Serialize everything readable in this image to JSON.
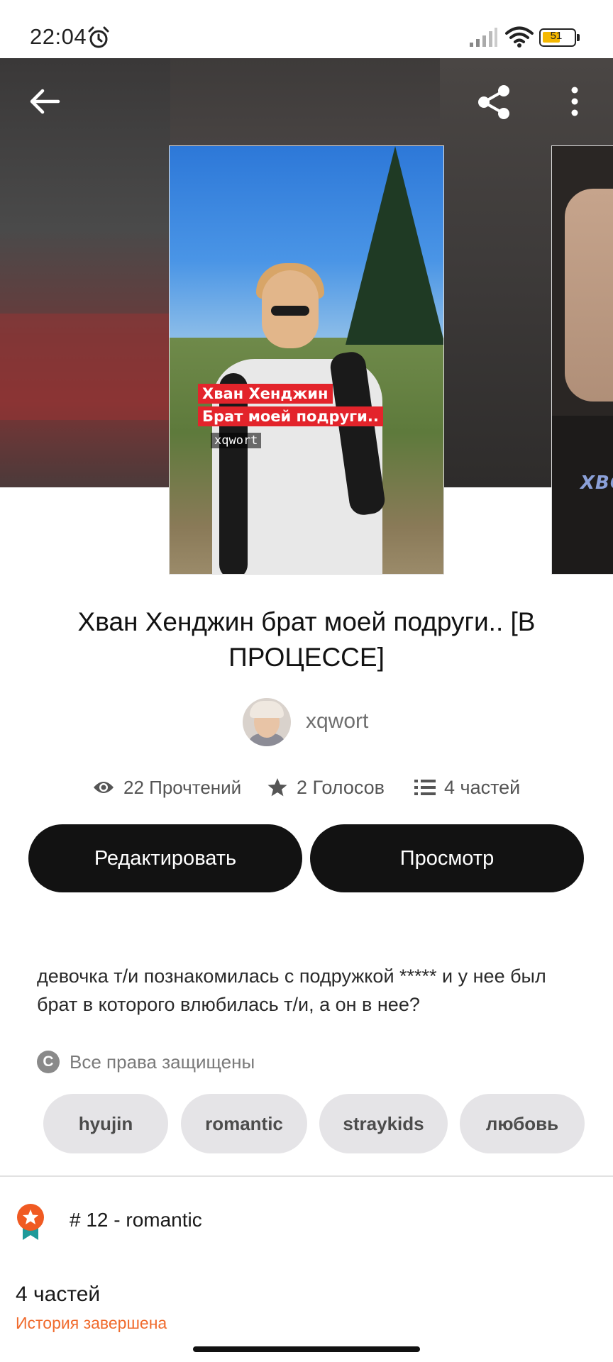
{
  "status_bar": {
    "time": "22:04",
    "battery_level": "51",
    "icons": [
      "alarm-icon",
      "signal-icon",
      "wifi-icon",
      "battery-icon"
    ]
  },
  "toolbar": {
    "icons": [
      "back-arrow-icon",
      "share-icon",
      "more-vertical-icon"
    ]
  },
  "cover": {
    "line1": "Хван Хенджин",
    "line2": "Брат моей подруги..",
    "author_watermark": "xqwort",
    "next_cover_text": "XBO"
  },
  "story": {
    "title": "Хван Хенджин брат моей подруги.. [В ПРОЦЕССЕ]",
    "author": "xqwort",
    "stats": {
      "reads": "22 Прочтений",
      "votes": "2 Голосов",
      "parts": "4 частей"
    },
    "description": "девочка т/и познакомилась с подружкой ***** и у нее был брат в которого влюбилась т/и, а он в нее?",
    "copyright": "Все права защищены",
    "tags": [
      "hyujin",
      "romantic",
      "straykids",
      "любовь"
    ]
  },
  "actions": {
    "edit_label": "Редактировать",
    "view_label": "Просмотр"
  },
  "ranking": {
    "text": "# 12 - romantic"
  },
  "footer": {
    "parts_count": "4 частей",
    "status": "История завершена"
  },
  "colors": {
    "button_bg": "#121212",
    "tag_bg": "#e5e4e7",
    "status_accent": "#f06a2c",
    "badge_orange": "#f05a22",
    "badge_teal": "#1f9a9a"
  }
}
